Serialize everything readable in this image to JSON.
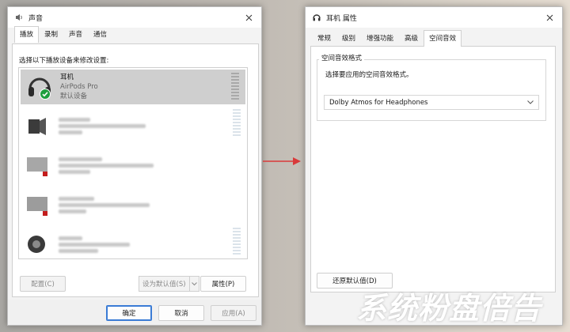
{
  "sound_dialog": {
    "title": "声音",
    "tabs": [
      "播放",
      "录制",
      "声音",
      "通信"
    ],
    "instruction": "选择以下播放设备来修改设置:",
    "devices": [
      {
        "name": "耳机",
        "model": "AirPods Pro",
        "status": "默认设备",
        "icon": "headphones-icon"
      },
      {
        "name": "",
        "model": "",
        "status": "",
        "icon": "speaker-icon"
      },
      {
        "name": "",
        "model": "",
        "status": "",
        "icon": "monitor-icon"
      },
      {
        "name": "",
        "model": "",
        "status": "",
        "icon": "monitor-icon"
      },
      {
        "name": "",
        "model": "",
        "status": "",
        "icon": "speaker-icon"
      }
    ],
    "buttons": {
      "configure": "配置(C)",
      "set_default": "设为默认值(S)",
      "properties": "属性(P)",
      "ok": "确定",
      "cancel": "取消",
      "apply": "应用(A)"
    }
  },
  "props_dialog": {
    "title": "耳机 属性",
    "tabs": [
      "常规",
      "级别",
      "增强功能",
      "高级",
      "空间音效"
    ],
    "group_label": "空间音效格式",
    "description": "选择要应用的空间音效格式。",
    "select_value": "Dolby Atmos for Headphones",
    "restore_button": "还原默认值(D)"
  },
  "watermark": "系统粉盘倍告",
  "colors": {
    "accent": "#3a7bd5",
    "arrow": "#d93a3a",
    "check": "#1e9e3e"
  }
}
